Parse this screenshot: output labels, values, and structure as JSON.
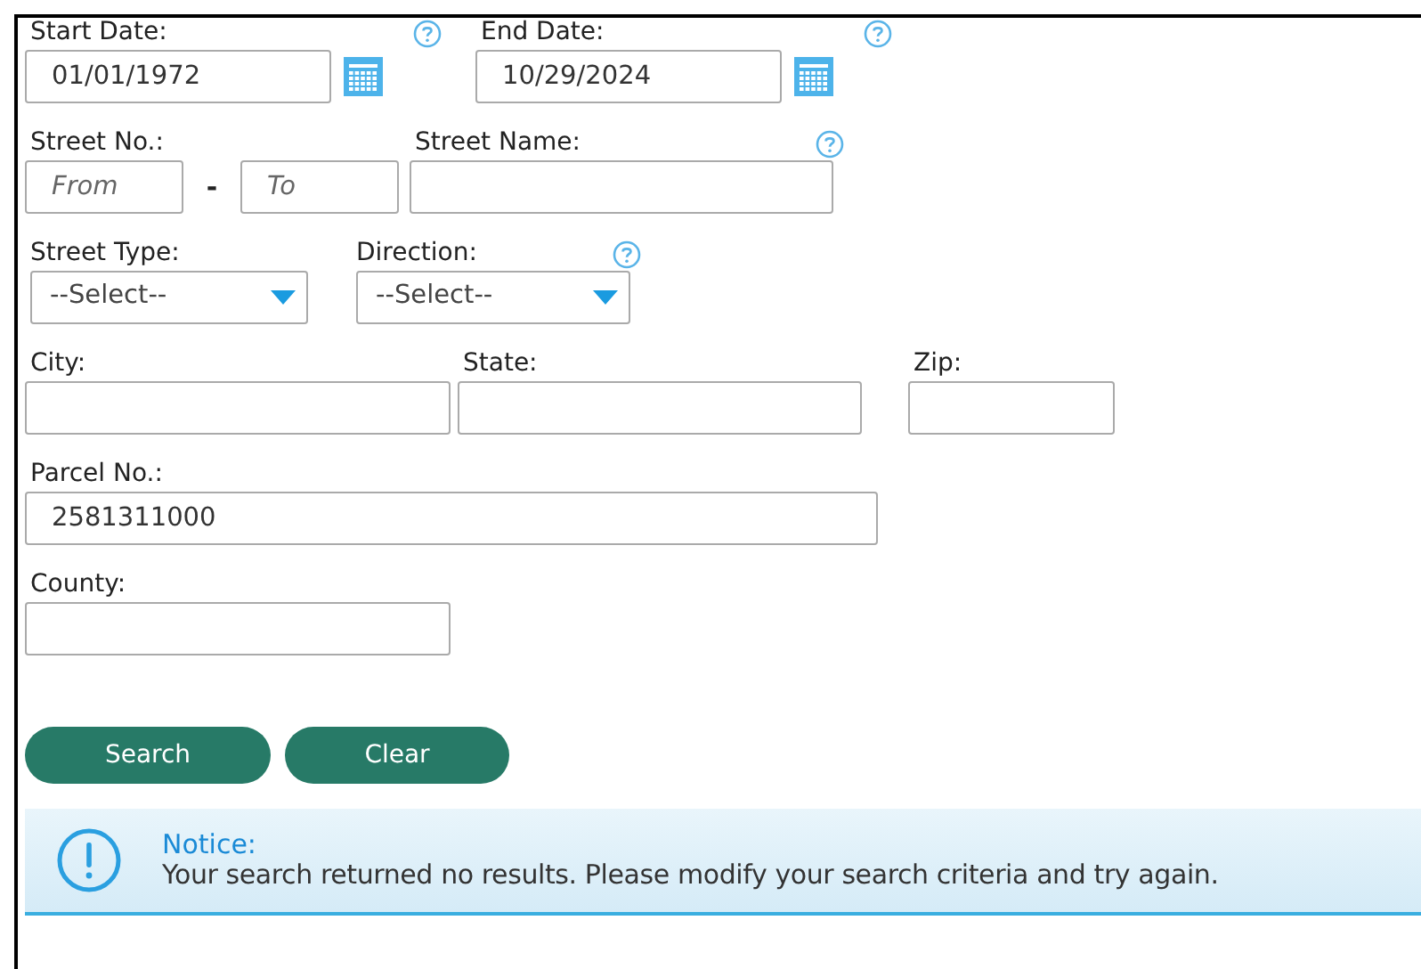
{
  "rows": [
    [
      {
        "kind": "date",
        "label": "Start Date:",
        "value": "01/01/1972",
        "help": true
      },
      {
        "kind": "date",
        "label": "End Date:",
        "value": "10/29/2024",
        "help": true
      }
    ],
    [
      {
        "kind": "range",
        "label": "Street No.:",
        "from_placeholder": "From",
        "separator": "-",
        "to_placeholder": "To",
        "help": false
      },
      {
        "kind": "text",
        "label": "Street Name:",
        "help": true
      }
    ],
    [
      {
        "kind": "select",
        "label": "Street Type:",
        "value": "--Select--",
        "help": false
      },
      {
        "kind": "select",
        "label": "Direction:",
        "value": "--Select--",
        "help": true
      }
    ],
    [
      {
        "kind": "text",
        "label": "City:",
        "help": false
      },
      {
        "kind": "text",
        "label": "State:",
        "help": false
      },
      {
        "kind": "text",
        "label": "Zip:",
        "help": false
      }
    ],
    [
      {
        "kind": "text",
        "label": "Parcel No.:",
        "value": "2581311000",
        "help": false
      }
    ],
    [
      {
        "kind": "text",
        "label": "County:",
        "help": false
      }
    ]
  ],
  "buttons": [
    "Search",
    "Clear"
  ],
  "notice": {
    "title": "Notice:",
    "message": "Your search returned no results. Please modify your search criteria and try again."
  }
}
